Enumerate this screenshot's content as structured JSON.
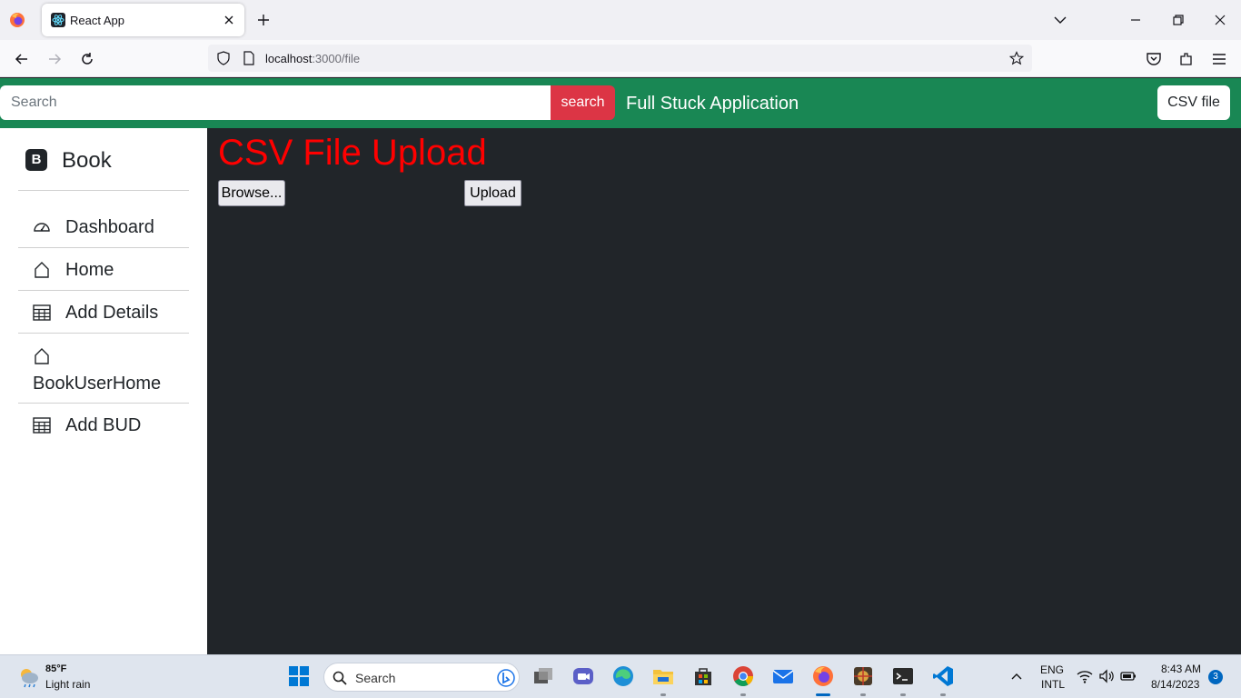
{
  "browser": {
    "tab_title": "React App",
    "url_host": "localhost",
    "url_rest": ":3000/file"
  },
  "header": {
    "search_placeholder": "Search",
    "search_button": "search",
    "brand_title": "Full Stuck Application",
    "csv_button": "CSV file"
  },
  "sidebar": {
    "brand_letter": "B",
    "brand_label": "Book",
    "items": [
      {
        "label": "Dashboard",
        "icon": "speedometer-icon"
      },
      {
        "label": "Home",
        "icon": "house-icon"
      },
      {
        "label": "Add Details",
        "icon": "table-icon"
      },
      {
        "label": "BookUserHome",
        "icon": "house-icon"
      },
      {
        "label": "Add BUD",
        "icon": "table-icon"
      }
    ]
  },
  "main": {
    "title": "CSV File Upload",
    "browse_button": "Browse...",
    "upload_button": "Upload"
  },
  "taskbar": {
    "weather_temp": "85°F",
    "weather_condition": "Light rain",
    "search_text": "Search",
    "lang_line1": "ENG",
    "lang_line2": "INTL",
    "time": "8:43 AM",
    "date": "8/14/2023",
    "notification_count": "3"
  },
  "colors": {
    "header_green": "#198754",
    "search_red": "#dc3545",
    "title_red": "#ff0000",
    "main_bg": "#212529"
  }
}
